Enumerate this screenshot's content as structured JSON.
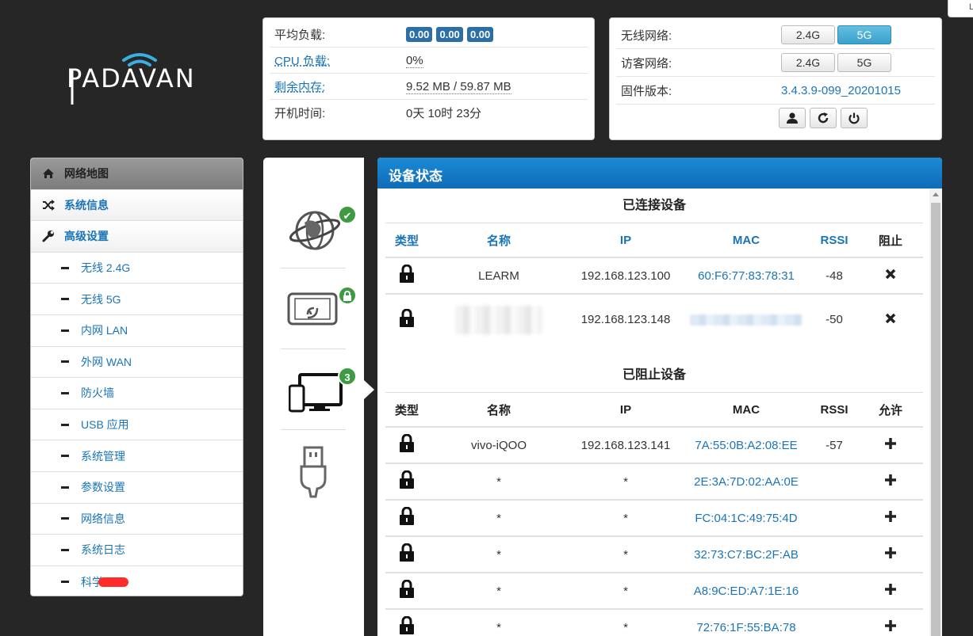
{
  "corner_tab": "L",
  "logo": {
    "text": "PADAVAN"
  },
  "system": {
    "load_label": "平均负载:",
    "load_values": [
      "0.00",
      "0.00",
      "0.00"
    ],
    "cpu_label": "CPU 负载:",
    "cpu_value": "0%",
    "mem_label": "剩余内存:",
    "mem_value": "9.52 MB / 59.87 MB",
    "uptime_label": "开机时间:",
    "uptime_value": "0天 10时 23分"
  },
  "wireless": {
    "wifi_label": "无线网络:",
    "wifi_bands": [
      "2.4G",
      "5G"
    ],
    "wifi_active": "5G",
    "guest_label": "访客网络:",
    "guest_bands": [
      "2.4G",
      "5G"
    ],
    "firmware_label": "固件版本:",
    "firmware_value": "3.4.3.9-099_20201015",
    "buttons": [
      "user-icon",
      "refresh-icon",
      "power-icon"
    ]
  },
  "sidebar": {
    "items": [
      {
        "label": "网络地图",
        "icon": "home-icon",
        "level": "top",
        "current": true
      },
      {
        "label": "系统信息",
        "icon": "shuffle-icon",
        "level": "top"
      },
      {
        "label": "高级设置",
        "icon": "wrench-icon",
        "level": "top"
      },
      {
        "label": "无线 2.4G",
        "level": "sub"
      },
      {
        "label": "无线 5G",
        "level": "sub"
      },
      {
        "label": "内网 LAN",
        "level": "sub"
      },
      {
        "label": "外网 WAN",
        "level": "sub"
      },
      {
        "label": "防火墙",
        "level": "sub"
      },
      {
        "label": "USB 应用",
        "level": "sub"
      },
      {
        "label": "系统管理",
        "level": "sub"
      },
      {
        "label": "参数设置",
        "level": "sub"
      },
      {
        "label": "网络信息",
        "level": "sub"
      },
      {
        "label": "系统日志",
        "level": "sub"
      },
      {
        "label": "科学",
        "level": "sub",
        "redacted": true
      }
    ]
  },
  "tabs": [
    {
      "name": "internet",
      "icon": "globe-icon",
      "badge": "✔"
    },
    {
      "name": "wireless",
      "icon": "tablet-wifi-icon",
      "badge": "lock"
    },
    {
      "name": "clients",
      "icon": "devices-icon",
      "badge": "3"
    },
    {
      "name": "usb",
      "icon": "usb-icon",
      "badge": ""
    }
  ],
  "status": {
    "title": "设备状态",
    "connected_title": "已连接设备",
    "connected_headers": [
      "类型",
      "名称",
      "IP",
      "MAC",
      "RSSI",
      "阻止"
    ],
    "connected": [
      {
        "name": "LEARM",
        "ip": "192.168.123.100",
        "mac": "60:F6:77:83:78:31",
        "rssi": "-48"
      },
      {
        "name": "",
        "ip": "192.168.123.148",
        "mac": "",
        "rssi": "-50",
        "blurred": true
      }
    ],
    "blocked_title": "已阻止设备",
    "blocked_headers": [
      "类型",
      "名称",
      "IP",
      "MAC",
      "RSSI",
      "允许"
    ],
    "blocked": [
      {
        "name": "vivo-iQOO",
        "ip": "192.168.123.141",
        "mac": "7A:55:0B:A2:08:EE",
        "rssi": "-57"
      },
      {
        "name": "*",
        "ip": "*",
        "mac": "2E:3A:7D:02:AA:0E",
        "rssi": ""
      },
      {
        "name": "*",
        "ip": "*",
        "mac": "FC:04:1C:49:75:4D",
        "rssi": ""
      },
      {
        "name": "*",
        "ip": "*",
        "mac": "32:73:C7:BC:2F:AB",
        "rssi": ""
      },
      {
        "name": "*",
        "ip": "*",
        "mac": "A8:9C:ED:A7:1E:16",
        "rssi": ""
      },
      {
        "name": "*",
        "ip": "*",
        "mac": "72:76:1F:55:BA:78",
        "rssi": ""
      }
    ]
  }
}
